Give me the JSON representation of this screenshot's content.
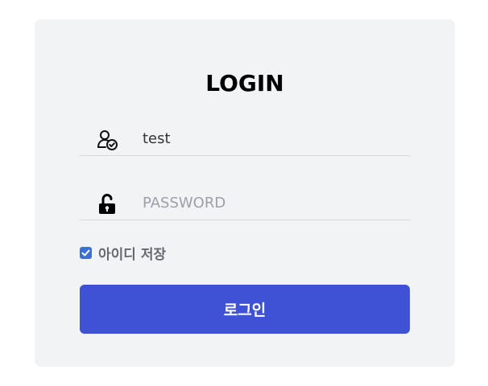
{
  "login": {
    "title": "LOGIN",
    "username": {
      "value": "test",
      "icon": "user-check-icon"
    },
    "password": {
      "value": "",
      "placeholder": "PASSWORD",
      "icon": "lock-open-icon"
    },
    "remember": {
      "label": "아이디 저장",
      "checked": true
    },
    "submit_label": "로그인"
  },
  "colors": {
    "card_background": "#f2f3f5",
    "button_background": "#3f51d4",
    "checkbox_accent": "#3a6fd8",
    "divider": "#d6d8db"
  }
}
